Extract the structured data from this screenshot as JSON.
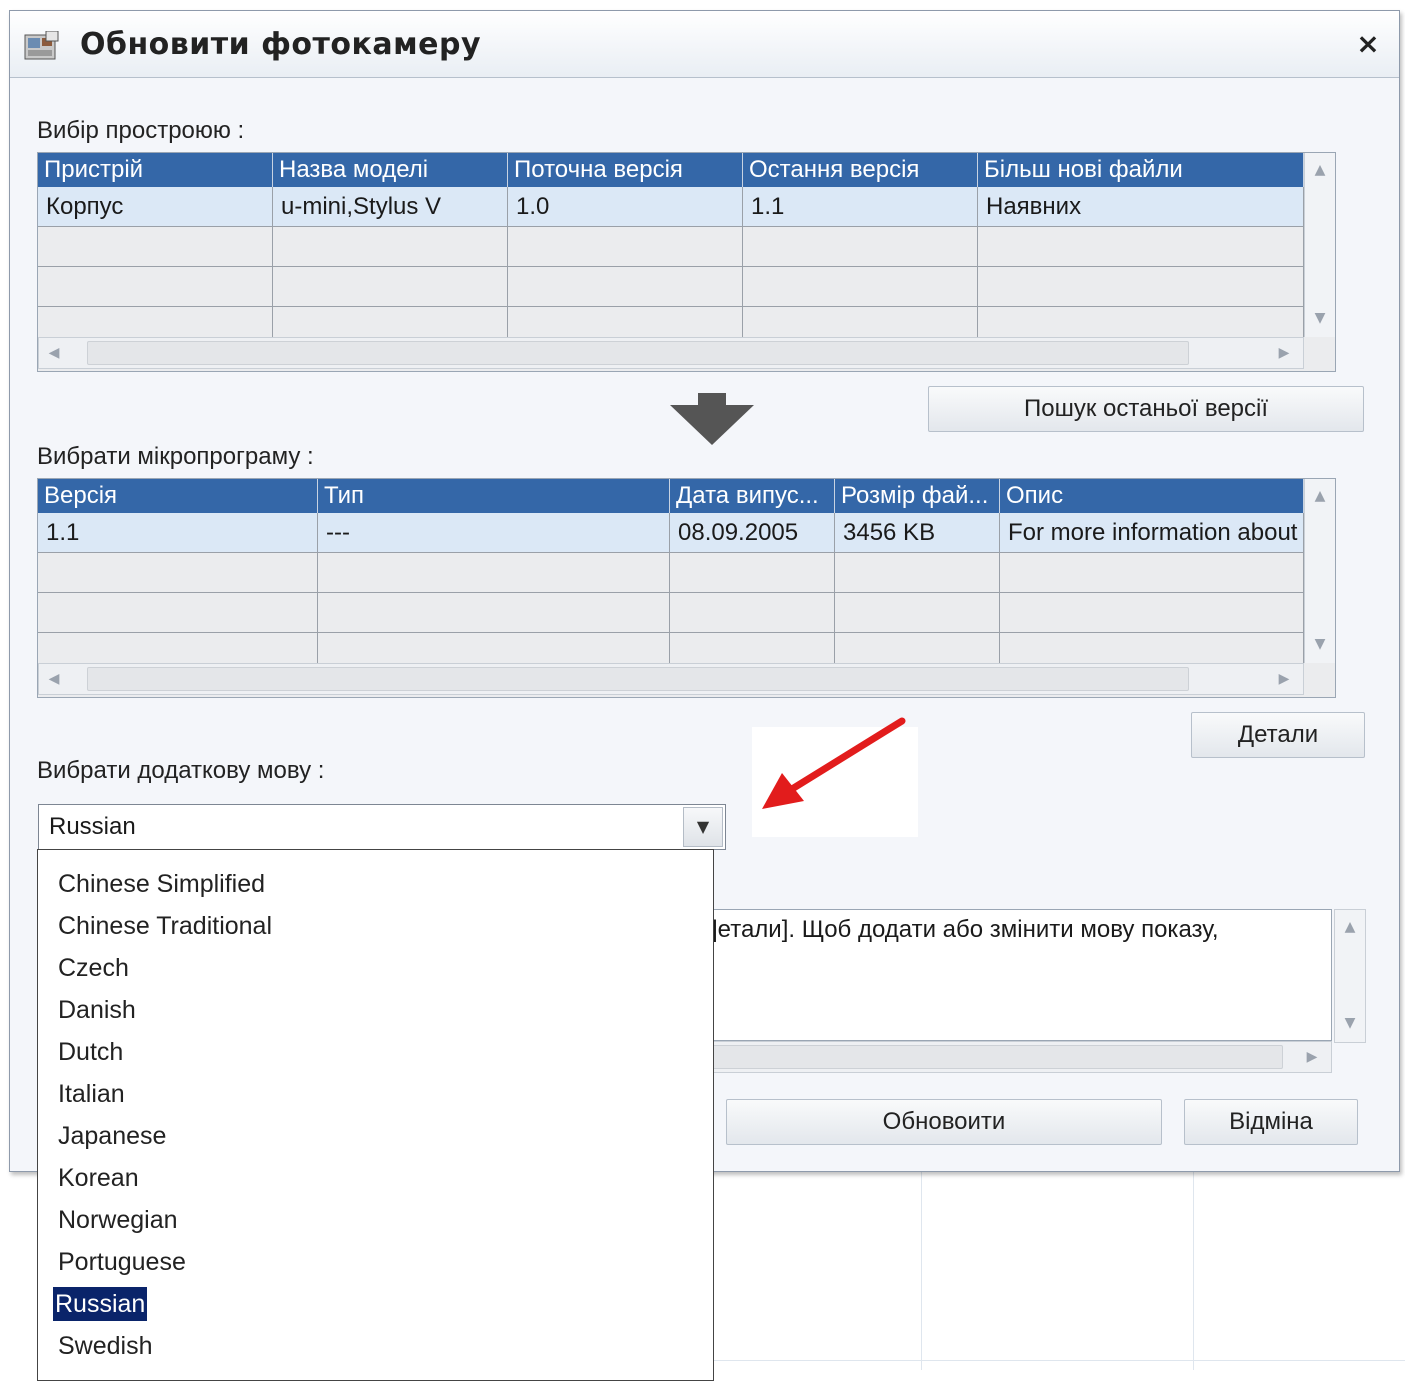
{
  "window": {
    "title": "Обновити фотокамеру",
    "close_label": "×"
  },
  "device_section": {
    "label": "Вибір простроюю :",
    "columns": [
      "Пристрій",
      "Назва моделі",
      "Поточна версія",
      "Остання версія",
      "Більш нові файли"
    ],
    "rows": [
      [
        "Корпус",
        "u-mini,Stylus V",
        "1.0",
        "1.1",
        "Наявних"
      ]
    ]
  },
  "search_button": "Пошук останьої версії",
  "firmware_section": {
    "label": "Вибрати мікропрограму :",
    "columns": [
      "Версія",
      "Тип",
      "Дата випус...",
      "Розмір фай...",
      "Опис"
    ],
    "rows": [
      [
        "1.1",
        "---",
        "08.09.2005",
        "3456 KB",
        "For more information about ..."
      ]
    ]
  },
  "details_button": "Детали",
  "language_section": {
    "label": "Вибрати додаткову мову :",
    "selected": "Russian",
    "options": [
      "Chinese Simplified",
      "Chinese Traditional",
      "Czech",
      "Danish",
      "Dutch",
      "Italian",
      "Japanese",
      "Korean",
      "Norwegian",
      "Portuguese",
      "Russian",
      "Swedish"
    ]
  },
  "info_text": "]етали]. Щоб додати або змінити мову показу,",
  "update_button": "Обновоити",
  "cancel_button": "Відміна",
  "colors": {
    "header_blue": "#3467a8",
    "selection_navy": "#0a246a",
    "arrow_red": "#e21c1c"
  }
}
